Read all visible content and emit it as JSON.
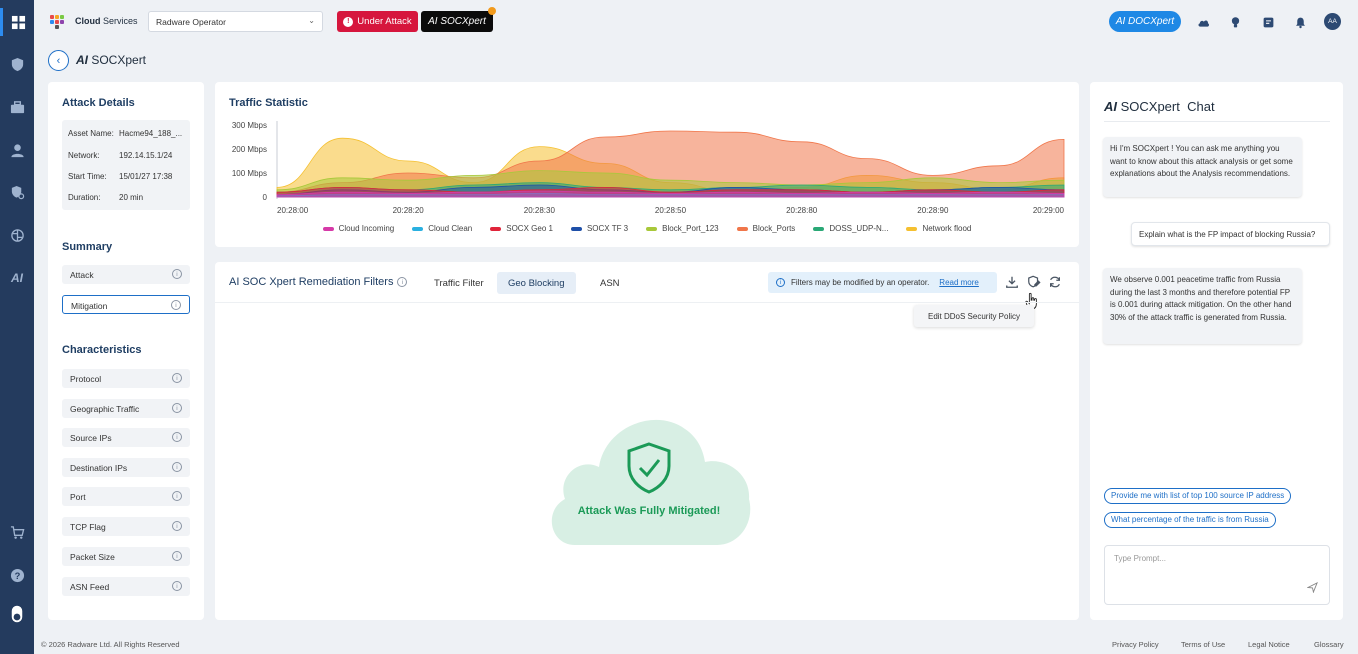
{
  "topbar": {
    "app_name_bold": "Cloud",
    "app_name_rest": " Services",
    "tenant": "Radware Operator",
    "under_attack": "Under Attack",
    "socx_badge": "AI SOCXpert",
    "docxpert_pill": "AI DOCXpert",
    "avatar": "AA"
  },
  "page": {
    "logo_ai": "AI",
    "logo_rest": " SOCXpert"
  },
  "attack_details": {
    "title": "Attack Details",
    "rows": [
      {
        "k": "Asset Name:",
        "v": "Hacme94_188_..."
      },
      {
        "k": "Network:",
        "v": "192.14.15.1/24"
      },
      {
        "k": "Start Time:",
        "v": "15/01/27 17:38"
      },
      {
        "k": "Duration:",
        "v": "20 min"
      }
    ]
  },
  "summary": {
    "title": "Summary",
    "items": [
      "Attack",
      "Mitigation"
    ]
  },
  "characteristics": {
    "title": "Characteristics",
    "items": [
      "Protocol",
      "Geographic Traffic",
      "Source IPs",
      "Destination IPs",
      "Port",
      "TCP Flag",
      "Packet Size",
      "ASN Feed"
    ]
  },
  "traffic": {
    "title": "Traffic Statistic"
  },
  "chart_data": {
    "type": "area",
    "title": "Traffic Statistic",
    "y_ticks": [
      "300 Mbps",
      "200 Mbps",
      "100 Mbps",
      "0"
    ],
    "ylim": [
      0,
      300
    ],
    "x_ticks": [
      "20:28:00",
      "20:28:20",
      "20:28:30",
      "20:28:50",
      "20:28:80",
      "20:28:90",
      "20:29:00"
    ],
    "legend": [
      "Cloud Incoming",
      "Cloud Clean",
      "SOCX Geo 1",
      "SOCX TF 3",
      "Block_Port_123",
      "Block_Ports",
      "DOSS_UDP-N...",
      "Network flood"
    ],
    "colors": [
      "#d63aa8",
      "#2ab0e0",
      "#e0243a",
      "#1e4fa8",
      "#a8c83a",
      "#f0764a",
      "#2aa876",
      "#f5c030"
    ],
    "series": [
      {
        "name": "Network flood",
        "values": [
          40,
          245,
          150,
          60,
          210,
          140,
          60,
          20,
          40,
          90,
          60,
          30,
          80
        ]
      },
      {
        "name": "Block_Ports",
        "values": [
          20,
          60,
          100,
          80,
          150,
          250,
          275,
          270,
          230,
          160,
          90,
          130,
          240
        ]
      },
      {
        "name": "Block_Port_123",
        "values": [
          30,
          80,
          70,
          90,
          110,
          100,
          70,
          60,
          50,
          60,
          80,
          60,
          70
        ]
      },
      {
        "name": "DOSS_UDP-N...",
        "values": [
          20,
          40,
          30,
          50,
          60,
          40,
          30,
          40,
          50,
          40,
          30,
          40,
          50
        ]
      },
      {
        "name": "SOCX TF 3",
        "values": [
          10,
          30,
          20,
          40,
          50,
          30,
          20,
          40,
          30,
          20,
          30,
          40,
          30
        ]
      },
      {
        "name": "SOCX Geo 1",
        "values": [
          20,
          40,
          30,
          20,
          30,
          40,
          20,
          30,
          30,
          20,
          30,
          20,
          30
        ]
      },
      {
        "name": "Cloud Clean",
        "values": [
          5,
          10,
          10,
          10,
          15,
          10,
          10,
          10,
          10,
          10,
          10,
          10,
          10
        ]
      },
      {
        "name": "Cloud Incoming",
        "values": [
          10,
          20,
          15,
          20,
          25,
          20,
          15,
          20,
          15,
          20,
          15,
          20,
          15
        ]
      }
    ]
  },
  "remediation": {
    "title": "AI SOC Xpert Remediation Filters",
    "tabs": [
      "Traffic Filter",
      "Geo Blocking",
      "ASN"
    ],
    "notice": "Filters may be modified by an operator.",
    "read_more": "Read more",
    "tooltip": "Edit DDoS Security Policy",
    "mitigated": "Attack Was Fully Mitigated!"
  },
  "chat": {
    "title_ai": "AI",
    "title_rest": " SOCXpert",
    "title_chat": "Chat",
    "messages": [
      "Hi I'm SOCXpert ! You can ask me anything you want to know about this attack analysis or get some explanations about the Analysis recommendations.",
      "Explain what is the FP impact of blocking Russia?",
      "We observe 0.001 peacetime traffic from Russia during the last 3 months and therefore potential FP is 0.001 during attack mitigation.  On the other hand 30% of the attack traffic is generated from Russia."
    ],
    "suggestions": [
      "Provide me with list of top 100 source IP address",
      "What percentage of the traffic is from Russia"
    ],
    "prompt_placeholder": "Type Prompt..."
  },
  "footer": {
    "copyright": "© 2026 Radware Ltd. All Rights Reserved",
    "links": [
      "Privacy Policy",
      "Terms of Use",
      "Legal Notice",
      "Glossary"
    ]
  }
}
